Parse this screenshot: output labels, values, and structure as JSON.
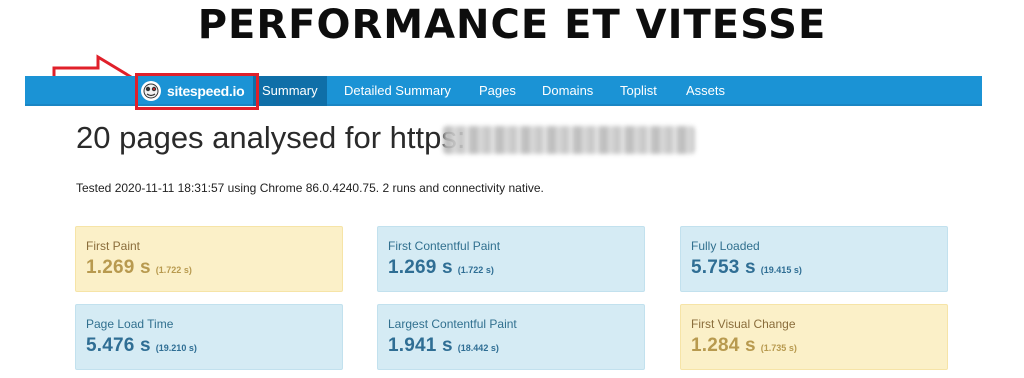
{
  "headline": "PERFORMANCE ET VITESSE",
  "brand": {
    "name": "sitespeed.io"
  },
  "nav": {
    "items": [
      {
        "label": "Summary",
        "active": true
      },
      {
        "label": "Detailed Summary",
        "active": false
      },
      {
        "label": "Pages",
        "active": false
      },
      {
        "label": "Domains",
        "active": false
      },
      {
        "label": "Toplist",
        "active": false
      },
      {
        "label": "Assets",
        "active": false
      }
    ]
  },
  "heading": {
    "text": "20 pages analysed for https:"
  },
  "tested_line": "Tested 2020-11-11 18:31:57 using Chrome 86.0.4240.75. 2 runs and connectivity native.",
  "metrics": [
    {
      "label": "First Paint",
      "value": "1.269 s",
      "sub": "(1.722 s)",
      "status": "warning"
    },
    {
      "label": "First Contentful Paint",
      "value": "1.269 s",
      "sub": "(1.722 s)",
      "status": "info"
    },
    {
      "label": "Fully Loaded",
      "value": "5.753 s",
      "sub": "(19.415 s)",
      "status": "info"
    },
    {
      "label": "Page Load Time",
      "value": "5.476 s",
      "sub": "(19.210 s)",
      "status": "info"
    },
    {
      "label": "Largest Contentful Paint",
      "value": "1.941 s",
      "sub": "(18.442 s)",
      "status": "info"
    },
    {
      "label": "First Visual Change",
      "value": "1.284 s",
      "sub": "(1.735 s)",
      "status": "warning"
    }
  ],
  "colors": {
    "navbar": "#1b93d5",
    "nav_active": "#0f6fa8",
    "highlight": "#e0202a",
    "warning_bg": "#fbf0c8",
    "info_bg": "#d5ebf4"
  },
  "icons": {
    "brand_logo": "sitespeed-logo-icon",
    "pointer": "arrow-right-icon"
  }
}
